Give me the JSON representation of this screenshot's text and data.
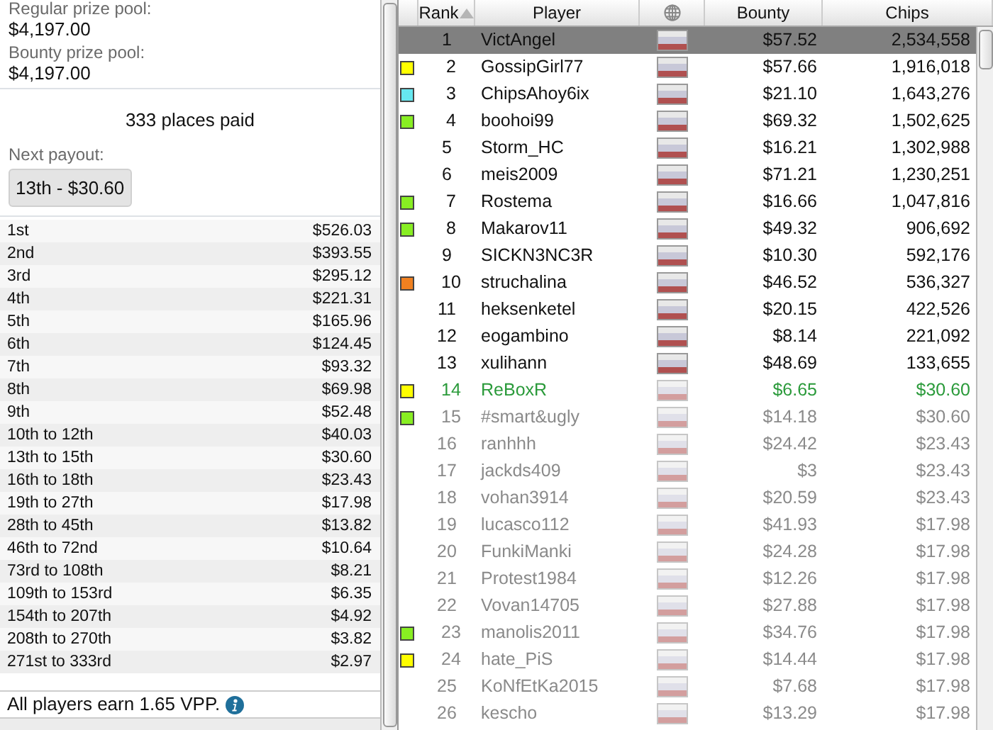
{
  "prize_info": {
    "regular_label": "Regular prize pool:",
    "regular_value": "$4,197.00",
    "bounty_label": "Bounty prize pool:",
    "bounty_value": "$4,197.00",
    "places_paid": "333 places paid",
    "next_label": "Next payout:",
    "next_value": "13th - $30.60"
  },
  "payouts": [
    {
      "place": "1st",
      "amount": "$526.03"
    },
    {
      "place": "2nd",
      "amount": "$393.55"
    },
    {
      "place": "3rd",
      "amount": "$295.12"
    },
    {
      "place": "4th",
      "amount": "$221.31"
    },
    {
      "place": "5th",
      "amount": "$165.96"
    },
    {
      "place": "6th",
      "amount": "$124.45"
    },
    {
      "place": "7th",
      "amount": "$93.32"
    },
    {
      "place": "8th",
      "amount": "$69.98"
    },
    {
      "place": "9th",
      "amount": "$52.48"
    },
    {
      "place": "10th to 12th",
      "amount": "$40.03"
    },
    {
      "place": "13th to 15th",
      "amount": "$30.60"
    },
    {
      "place": "16th to 18th",
      "amount": "$23.43"
    },
    {
      "place": "19th to 27th",
      "amount": "$17.98"
    },
    {
      "place": "28th to 45th",
      "amount": "$13.82"
    },
    {
      "place": "46th to 72nd",
      "amount": "$10.64"
    },
    {
      "place": "73rd to 108th",
      "amount": "$8.21"
    },
    {
      "place": "109th to 153rd",
      "amount": "$6.35"
    },
    {
      "place": "154th to 207th",
      "amount": "$4.92"
    },
    {
      "place": "208th to 270th",
      "amount": "$3.82"
    },
    {
      "place": "271st to 333rd",
      "amount": "$2.97"
    }
  ],
  "footer": {
    "text": "All players earn 1.65 VPP."
  },
  "table": {
    "columns": [
      {
        "kind": "text",
        "label": "Rank",
        "sorted": true
      },
      {
        "kind": "text",
        "label": "Player",
        "sorted": false
      },
      {
        "kind": "globe",
        "sorted": false
      },
      {
        "kind": "text",
        "label": "Bounty",
        "sorted": false
      },
      {
        "kind": "text",
        "label": "Chips",
        "sorted": false
      }
    ],
    "rows": [
      {
        "rank": "1",
        "player": "VictAngel",
        "bounty": "$57.52",
        "chips": "2,534,558",
        "eliminated": false,
        "highlighted": false,
        "selected": true
      },
      {
        "rank": "2",
        "player": "GossipGirl77",
        "bounty": "$57.66",
        "chips": "1,916,018",
        "eliminated": false,
        "highlighted": false,
        "selected": false,
        "color": "#ffff00"
      },
      {
        "rank": "3",
        "player": "ChipsAhoy6ix",
        "bounty": "$21.10",
        "chips": "1,643,276",
        "eliminated": false,
        "highlighted": false,
        "selected": false,
        "color": "#66e8f0"
      },
      {
        "rank": "4",
        "player": "boohoi99",
        "bounty": "$69.32",
        "chips": "1,502,625",
        "eliminated": false,
        "highlighted": false,
        "selected": false,
        "color": "#88ee22"
      },
      {
        "rank": "5",
        "player": "Storm_HC",
        "bounty": "$16.21",
        "chips": "1,302,988",
        "eliminated": false,
        "highlighted": false,
        "selected": false
      },
      {
        "rank": "6",
        "player": "meis2009",
        "bounty": "$71.21",
        "chips": "1,230,251",
        "eliminated": false,
        "highlighted": false,
        "selected": false
      },
      {
        "rank": "7",
        "player": "Rostema",
        "bounty": "$16.66",
        "chips": "1,047,816",
        "eliminated": false,
        "highlighted": false,
        "selected": false,
        "color": "#88ee22"
      },
      {
        "rank": "8",
        "player": "Makarov11",
        "bounty": "$49.32",
        "chips": "906,692",
        "eliminated": false,
        "highlighted": false,
        "selected": false,
        "color": "#88ee22"
      },
      {
        "rank": "9",
        "player": "SICKN3NC3R",
        "bounty": "$10.30",
        "chips": "592,176",
        "eliminated": false,
        "highlighted": false,
        "selected": false
      },
      {
        "rank": "10",
        "player": "struchalina",
        "bounty": "$46.52",
        "chips": "536,327",
        "eliminated": false,
        "highlighted": false,
        "selected": false,
        "color": "#f08020"
      },
      {
        "rank": "11",
        "player": "heksenketel",
        "bounty": "$20.15",
        "chips": "422,526",
        "eliminated": false,
        "highlighted": false,
        "selected": false
      },
      {
        "rank": "12",
        "player": "eogambino",
        "bounty": "$8.14",
        "chips": "221,092",
        "eliminated": false,
        "highlighted": false,
        "selected": false
      },
      {
        "rank": "13",
        "player": "xulihann",
        "bounty": "$48.69",
        "chips": "133,655",
        "eliminated": false,
        "highlighted": false,
        "selected": false
      },
      {
        "rank": "14",
        "player": "ReBoxR",
        "bounty": "$6.65",
        "chips": "$30.60",
        "eliminated": true,
        "highlighted": true,
        "selected": false,
        "color": "#ffff00"
      },
      {
        "rank": "15",
        "player": "#smart&ugly",
        "bounty": "$14.18",
        "chips": "$30.60",
        "eliminated": true,
        "highlighted": false,
        "selected": false,
        "color": "#88ee22"
      },
      {
        "rank": "16",
        "player": "ranhhh",
        "bounty": "$24.42",
        "chips": "$23.43",
        "eliminated": true,
        "highlighted": false,
        "selected": false
      },
      {
        "rank": "17",
        "player": "jackds409",
        "bounty": "$3",
        "chips": "$23.43",
        "eliminated": true,
        "highlighted": false,
        "selected": false
      },
      {
        "rank": "18",
        "player": "vohan3914",
        "bounty": "$20.59",
        "chips": "$23.43",
        "eliminated": true,
        "highlighted": false,
        "selected": false
      },
      {
        "rank": "19",
        "player": "lucasco112",
        "bounty": "$41.93",
        "chips": "$17.98",
        "eliminated": true,
        "highlighted": false,
        "selected": false
      },
      {
        "rank": "20",
        "player": "FunkiManki",
        "bounty": "$24.28",
        "chips": "$17.98",
        "eliminated": true,
        "highlighted": false,
        "selected": false
      },
      {
        "rank": "21",
        "player": "Protest1984",
        "bounty": "$12.26",
        "chips": "$17.98",
        "eliminated": true,
        "highlighted": false,
        "selected": false
      },
      {
        "rank": "22",
        "player": "Vovan14705",
        "bounty": "$27.88",
        "chips": "$17.98",
        "eliminated": true,
        "highlighted": false,
        "selected": false
      },
      {
        "rank": "23",
        "player": "manolis2011",
        "bounty": "$34.76",
        "chips": "$17.98",
        "eliminated": true,
        "highlighted": false,
        "selected": false,
        "color": "#88ee22"
      },
      {
        "rank": "24",
        "player": "hate_PiS",
        "bounty": "$14.44",
        "chips": "$17.98",
        "eliminated": true,
        "highlighted": false,
        "selected": false,
        "color": "#ffff00"
      },
      {
        "rank": "25",
        "player": "KoNfEtKa2015",
        "bounty": "$7.68",
        "chips": "$17.98",
        "eliminated": true,
        "highlighted": false,
        "selected": false
      },
      {
        "rank": "26",
        "player": "kescho",
        "bounty": "$13.29",
        "chips": "$17.98",
        "eliminated": true,
        "highlighted": false,
        "selected": false
      }
    ]
  }
}
